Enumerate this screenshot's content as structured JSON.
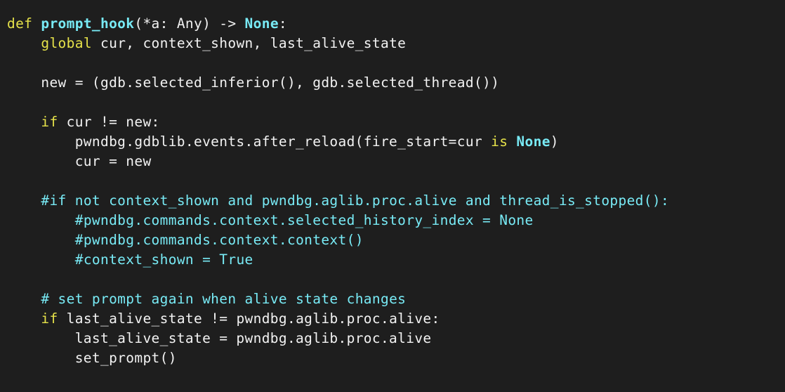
{
  "lines": [
    {
      "segments": [
        {
          "t": "def",
          "c": "kw"
        },
        {
          "t": " ",
          "c": ""
        },
        {
          "t": "prompt_hook",
          "c": "fn"
        },
        {
          "t": "(*a: Any) -> ",
          "c": ""
        },
        {
          "t": "None",
          "c": "const"
        },
        {
          "t": ":",
          "c": ""
        }
      ]
    },
    {
      "segments": [
        {
          "t": "    ",
          "c": ""
        },
        {
          "t": "global",
          "c": "kw"
        },
        {
          "t": " cur, context_shown, last_alive_state",
          "c": ""
        }
      ]
    },
    {
      "segments": []
    },
    {
      "segments": [
        {
          "t": "    new = (gdb.selected_inferior(), gdb.selected_thread())",
          "c": ""
        }
      ]
    },
    {
      "segments": []
    },
    {
      "segments": [
        {
          "t": "    ",
          "c": ""
        },
        {
          "t": "if",
          "c": "kw"
        },
        {
          "t": " cur != new:",
          "c": ""
        }
      ]
    },
    {
      "segments": [
        {
          "t": "        pwndbg.gdblib.events.after_reload(fire_start=cur ",
          "c": ""
        },
        {
          "t": "is",
          "c": "kw"
        },
        {
          "t": " ",
          "c": ""
        },
        {
          "t": "None",
          "c": "const"
        },
        {
          "t": ")",
          "c": ""
        }
      ]
    },
    {
      "segments": [
        {
          "t": "        cur = new",
          "c": ""
        }
      ]
    },
    {
      "segments": []
    },
    {
      "segments": [
        {
          "t": "    ",
          "c": ""
        },
        {
          "t": "#if not context_shown and pwndbg.aglib.proc.alive and thread_is_stopped():",
          "c": "comment"
        }
      ]
    },
    {
      "segments": [
        {
          "t": "        ",
          "c": ""
        },
        {
          "t": "#pwndbg.commands.context.selected_history_index = None",
          "c": "comment"
        }
      ]
    },
    {
      "segments": [
        {
          "t": "        ",
          "c": ""
        },
        {
          "t": "#pwndbg.commands.context.context()",
          "c": "comment"
        }
      ]
    },
    {
      "segments": [
        {
          "t": "        ",
          "c": ""
        },
        {
          "t": "#context_shown = True",
          "c": "comment"
        }
      ]
    },
    {
      "segments": []
    },
    {
      "segments": [
        {
          "t": "    ",
          "c": ""
        },
        {
          "t": "# set prompt again when alive state changes",
          "c": "comment"
        }
      ]
    },
    {
      "segments": [
        {
          "t": "    ",
          "c": ""
        },
        {
          "t": "if",
          "c": "kw"
        },
        {
          "t": " last_alive_state != pwndbg.aglib.proc.alive:",
          "c": ""
        }
      ]
    },
    {
      "segments": [
        {
          "t": "        last_alive_state = pwndbg.aglib.proc.alive",
          "c": ""
        }
      ]
    },
    {
      "segments": [
        {
          "t": "        set_prompt()",
          "c": ""
        }
      ]
    }
  ],
  "colors": {
    "background": "#1e1e1e",
    "text": "#f2f2f2",
    "keyword": "#e6e24a",
    "function_name": "#78eaf5",
    "constant": "#78eaf5",
    "comment": "#78eaf5"
  }
}
